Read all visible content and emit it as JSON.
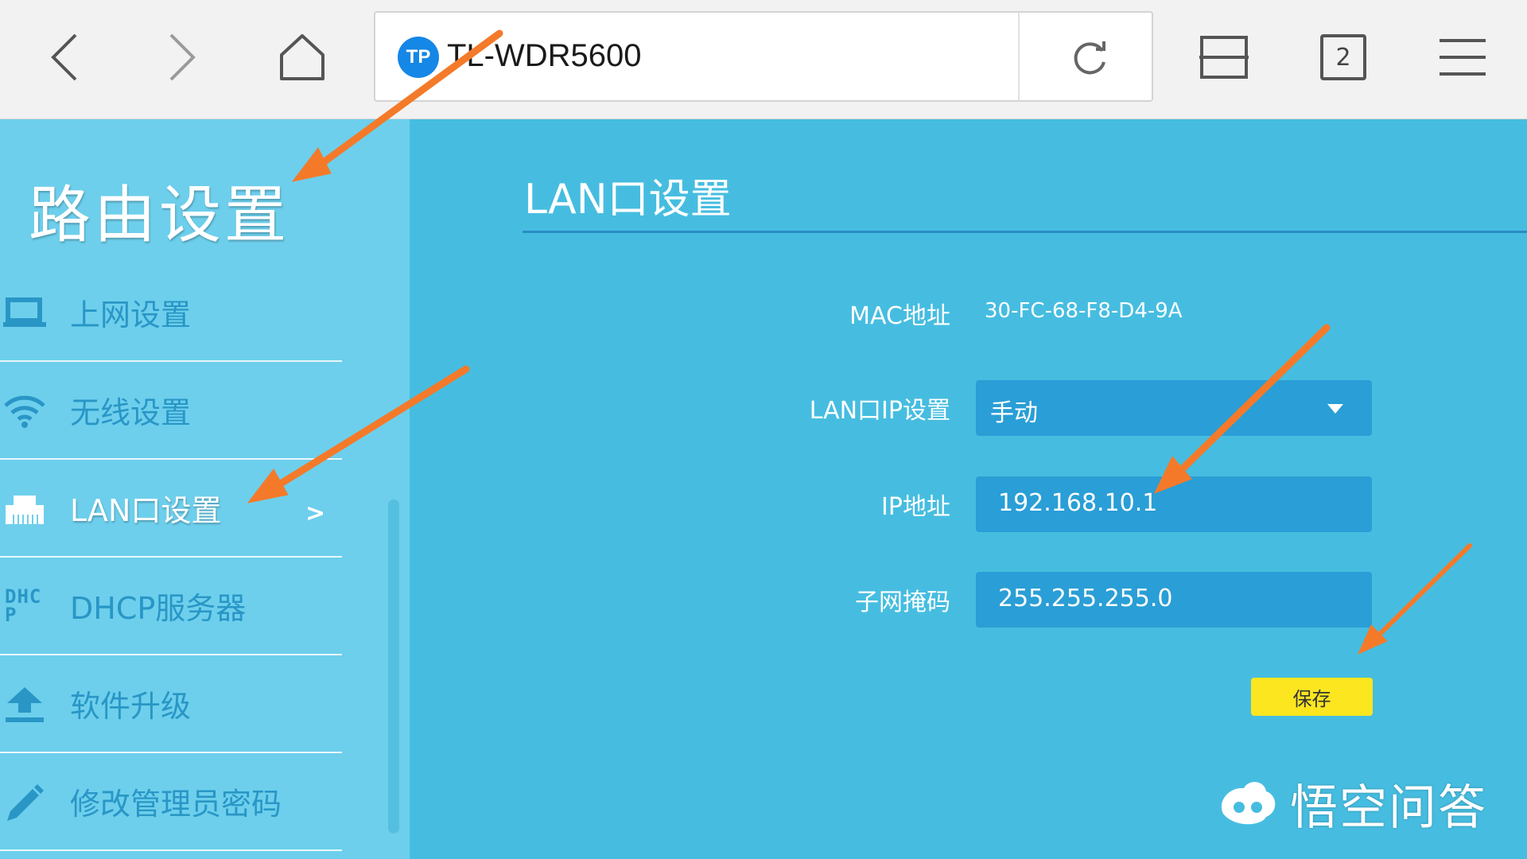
{
  "browser": {
    "url_title": "TL-WDR5600",
    "site_logo": "TP",
    "tab_count": "2",
    "icons": [
      "back-icon",
      "forward-icon",
      "home-icon",
      "reload-icon",
      "reader-mode-icon",
      "tabs-icon",
      "menu-icon"
    ]
  },
  "sidebar": {
    "title": "路由设置",
    "items": [
      {
        "label": "上网设置",
        "icon": "laptop-icon"
      },
      {
        "label": "无线设置",
        "icon": "wifi-icon"
      },
      {
        "label": "LAN口设置",
        "icon": "lan-port-icon",
        "active": true,
        "chevron": ">"
      },
      {
        "label": "DHCP服务器",
        "icon": "dhcp-icon",
        "icon_text": "DHCP"
      },
      {
        "label": "软件升级",
        "icon": "upload-icon"
      },
      {
        "label": "修改管理员密码",
        "icon": "pencil-icon"
      }
    ]
  },
  "main": {
    "title": "LAN口设置",
    "mac_label": "MAC地址",
    "mac_value": "30-FC-68-F8-D4-9A",
    "lan_ip_mode_label": "LAN口IP设置",
    "lan_ip_mode_value": "手动",
    "ip_label": "IP地址",
    "ip_value": "192.168.10.1",
    "subnet_label": "子网掩码",
    "subnet_value": "255.255.255.0",
    "save_label": "保存"
  },
  "watermark": {
    "text": "悟空问答"
  },
  "colors": {
    "sidebar_bg": "#6dcfec",
    "main_bg": "#46bde0",
    "field_bg": "#2a9ed6",
    "save_button": "#fbe61f",
    "annotation_arrow": "#f47a2a"
  }
}
